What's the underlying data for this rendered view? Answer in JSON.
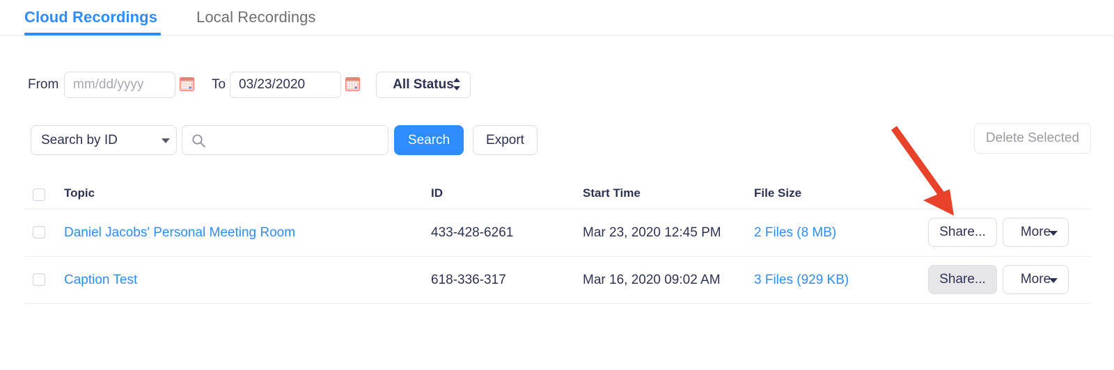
{
  "tabs": [
    {
      "label": "Cloud Recordings",
      "active": true
    },
    {
      "label": "Local Recordings",
      "active": false
    }
  ],
  "filters": {
    "from_label": "From",
    "from_value": "",
    "from_placeholder": "mm/dd/yyyy",
    "to_label": "To",
    "to_value": "03/23/2020",
    "to_placeholder": "mm/dd/yyyy",
    "calendar_icon": "calendar-icon",
    "status_value": "All Status",
    "status_options": [
      "All Status"
    ]
  },
  "search": {
    "search_by_value": "Search by  ID",
    "search_by_options": [
      "Search by  ID"
    ],
    "input_value": "",
    "input_placeholder": "",
    "icon": "search-icon",
    "search_button": "Search",
    "export_button": "Export",
    "delete_selected_button": "Delete Selected",
    "delete_selected_disabled": true
  },
  "table": {
    "columns": [
      "Topic",
      "ID",
      "Start Time",
      "File Size"
    ],
    "rows": [
      {
        "topic": "Daniel Jacobs' Personal Meeting Room",
        "id": "433-428-6261",
        "start_time": "Mar 23, 2020 12:45 PM",
        "file_size": "2 Files (8 MB)",
        "share_button": "Share...",
        "more_button": "More",
        "share_active": false,
        "selected": false
      },
      {
        "topic": "Caption Test",
        "id": "618-336-317",
        "start_time": "Mar 16, 2020 09:02 AM",
        "file_size": "3 Files (929 KB)",
        "share_button": "Share...",
        "more_button": "More",
        "share_active": true,
        "selected": false
      }
    ]
  },
  "annotation": {
    "type": "arrow",
    "name": "red-arrow-annotation",
    "color": "#e8422a",
    "points_to": "Share... button on first recording row"
  },
  "colors": {
    "accent_blue": "#2d8cff",
    "text": "#2d3251",
    "muted": "#6e6e73",
    "border": "#dcdce3",
    "annotation_red": "#e8422a"
  }
}
